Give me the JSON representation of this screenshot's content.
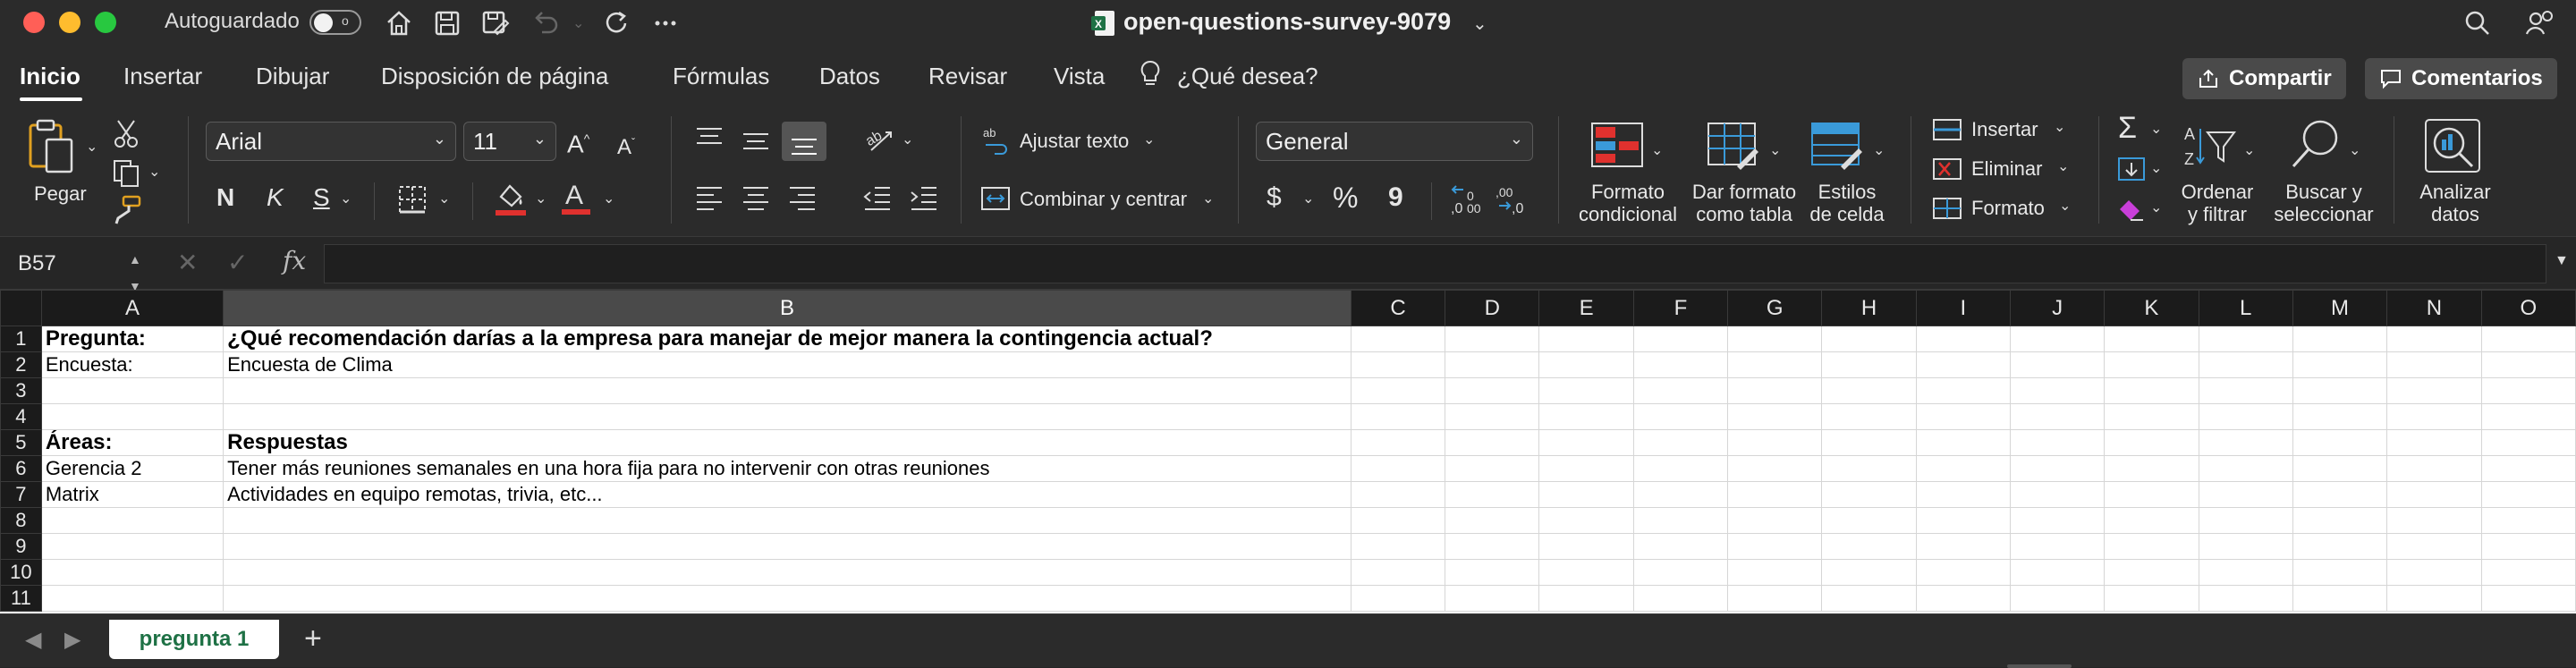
{
  "colors": {
    "accent_green": "#1e7145",
    "close": "#ff5f57",
    "minimize": "#febc2e",
    "maximize": "#28c840",
    "font_red": "#e0312e"
  },
  "titlebar": {
    "autosave_label": "Autoguardado",
    "autosave_state": "o",
    "doc_title": "open-questions-survey-9079",
    "icons": [
      "home-icon",
      "save-icon",
      "save-as-icon",
      "undo-icon",
      "redo-icon",
      "more-icon",
      "search-icon",
      "account-icon"
    ]
  },
  "tabs": {
    "items": [
      "Inicio",
      "Insertar",
      "Dibujar",
      "Disposición de página",
      "Fórmulas",
      "Datos",
      "Revisar",
      "Vista"
    ],
    "tell_me": "¿Qué desea?",
    "share_label": "Compartir",
    "comments_label": "Comentarios"
  },
  "ribbon": {
    "paste_label": "Pegar",
    "font_name": "Arial",
    "font_size": "11",
    "bold": "N",
    "italic": "K",
    "underline": "S",
    "wrap_text": "Ajustar texto",
    "merge_center": "Combinar y centrar",
    "number_format": "General",
    "currency": "$",
    "percent": "%",
    "comma": "9",
    "cond_format": [
      "Formato",
      "condicional"
    ],
    "format_table": [
      "Dar formato",
      "como tabla"
    ],
    "cell_styles": [
      "Estilos",
      "de celda"
    ],
    "insert": "Insertar",
    "delete": "Eliminar",
    "format": "Formato",
    "sort_filter": [
      "Ordenar",
      "y filtrar"
    ],
    "find_select": [
      "Buscar y",
      "seleccionar"
    ],
    "analyze": [
      "Analizar",
      "datos"
    ]
  },
  "formula_bar": {
    "cell_ref": "B57",
    "fx": "fx",
    "value": ""
  },
  "grid": {
    "columns": [
      "A",
      "B",
      "C",
      "D",
      "E",
      "F",
      "G",
      "H",
      "I",
      "J",
      "K",
      "L",
      "M",
      "N",
      "O"
    ],
    "rows": [
      {
        "n": "1",
        "a": "Pregunta:",
        "b": "¿Qué recomendación darías a la empresa para manejar de mejor manera la contingencia actual?",
        "bold": true
      },
      {
        "n": "2",
        "a": "Encuesta:",
        "b": "Encuesta de Clima",
        "bold": false
      },
      {
        "n": "3",
        "a": "",
        "b": "",
        "bold": false
      },
      {
        "n": "4",
        "a": "",
        "b": "",
        "bold": false
      },
      {
        "n": "5",
        "a": "Áreas:",
        "b": "Respuestas",
        "bold": true
      },
      {
        "n": "6",
        "a": "Gerencia 2",
        "b": "Tener más reuniones semanales en una hora fija para no intervenir con otras reuniones",
        "bold": false
      },
      {
        "n": "7",
        "a": "Matrix",
        "b": "Actividades en equipo remotas, trivia, etc...",
        "bold": false
      },
      {
        "n": "8",
        "a": "",
        "b": "",
        "bold": false
      },
      {
        "n": "9",
        "a": "",
        "b": "",
        "bold": false
      },
      {
        "n": "10",
        "a": "",
        "b": "",
        "bold": false
      },
      {
        "n": "11",
        "a": "",
        "b": "",
        "bold": false
      }
    ]
  },
  "sheets": {
    "active": "pregunta 1",
    "add": "+"
  }
}
